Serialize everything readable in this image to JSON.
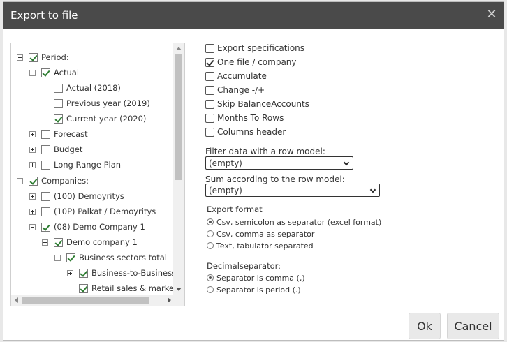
{
  "dialog": {
    "title": "Export to file"
  },
  "tree": [
    {
      "label": "Period:",
      "indent": 0,
      "expander": "minus",
      "checked": true
    },
    {
      "label": "Actual",
      "indent": 1,
      "expander": "minus",
      "checked": true
    },
    {
      "label": "Actual (2018)",
      "indent": 2,
      "expander": "none",
      "checked": false
    },
    {
      "label": "Previous year (2019)",
      "indent": 2,
      "expander": "none",
      "checked": false
    },
    {
      "label": "Current year (2020)",
      "indent": 2,
      "expander": "none",
      "checked": true
    },
    {
      "label": "Forecast",
      "indent": 1,
      "expander": "plus",
      "checked": false
    },
    {
      "label": "Budget",
      "indent": 1,
      "expander": "plus",
      "checked": false
    },
    {
      "label": "Long Range Plan",
      "indent": 1,
      "expander": "plus",
      "checked": false
    },
    {
      "label": "Companies:",
      "indent": 0,
      "expander": "minus",
      "checked": true
    },
    {
      "label": "(100) Demoyritys",
      "indent": 1,
      "expander": "plus",
      "checked": false
    },
    {
      "label": "(10P) Palkat / Demoyritys",
      "indent": 1,
      "expander": "plus",
      "checked": false
    },
    {
      "label": "(08) Demo Company 1",
      "indent": 1,
      "expander": "minus",
      "checked": true
    },
    {
      "label": "Demo company 1",
      "indent": 2,
      "expander": "minus",
      "checked": true
    },
    {
      "label": "Business sectors total",
      "indent": 3,
      "expander": "minus",
      "checked": true
    },
    {
      "label": "Business-to-Business",
      "indent": 4,
      "expander": "plus",
      "checked": true
    },
    {
      "label": "Retail sales & marketing",
      "indent": 4,
      "expander": "none",
      "checked": true
    }
  ],
  "options": [
    {
      "label": "Export specifications",
      "checked": false
    },
    {
      "label": "One file / company",
      "checked": true
    },
    {
      "label": "Accumulate",
      "checked": false
    },
    {
      "label": "Change -/+",
      "checked": false
    },
    {
      "label": "Skip BalanceAccounts",
      "checked": false
    },
    {
      "label": "Months To Rows",
      "checked": false
    },
    {
      "label": "Columns header",
      "checked": false
    }
  ],
  "filter": {
    "label": "Filter data with a row model:",
    "value": "(empty)"
  },
  "sum": {
    "label": "Sum according to the row model:",
    "value": "(empty)"
  },
  "export_format": {
    "label": "Export format",
    "options": [
      {
        "label": "Csv, semicolon as separator (excel format)",
        "selected": true
      },
      {
        "label": "Csv, comma as separator",
        "selected": false
      },
      {
        "label": "Text, tabulator separated",
        "selected": false
      }
    ]
  },
  "decimal": {
    "label": "Decimalseparator:",
    "options": [
      {
        "label": "Separator is comma (,)",
        "selected": true
      },
      {
        "label": "Separator is period (.)",
        "selected": false
      }
    ]
  },
  "buttons": {
    "ok": "Ok",
    "cancel": "Cancel"
  },
  "icons": {
    "close": "close-icon"
  }
}
